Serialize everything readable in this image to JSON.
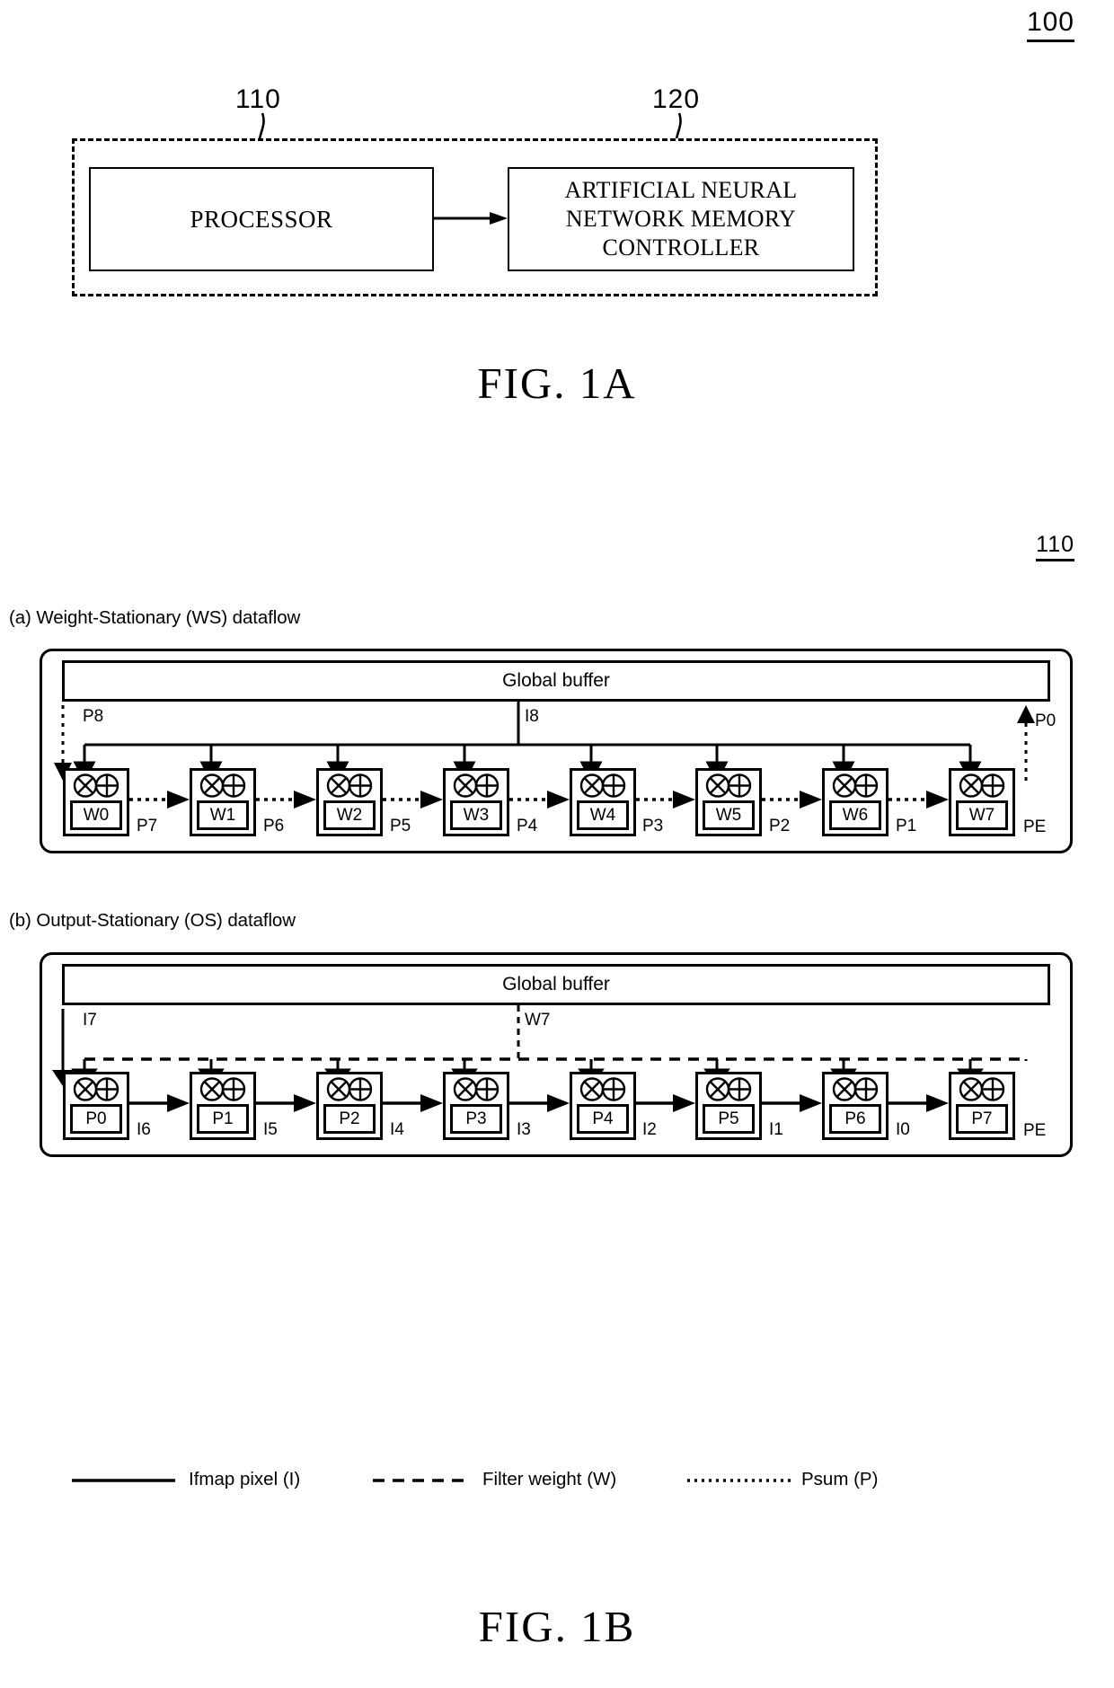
{
  "figure_1a": {
    "ref_number": "100",
    "caption": "FIG. 1A",
    "processor": {
      "ref": "110",
      "label": "PROCESSOR"
    },
    "memory_controller": {
      "ref": "120",
      "label": "ARTIFICIAL NEURAL NETWORK MEMORY CONTROLLER"
    },
    "memory_controller_lines": [
      "ARTIFICIAL NEURAL",
      "NETWORK MEMORY",
      "CONTROLLER"
    ]
  },
  "figure_1b": {
    "ref_number": "110",
    "caption": "FIG. 1B",
    "global_buffer_label": "Global buffer",
    "pe_label": "PE",
    "ws": {
      "title": "(a) Weight-Stationary (WS) dataflow",
      "psum_in_label": "P8",
      "ifmap_bus_label": "I8",
      "psum_out_label": "P0",
      "cells": [
        "W0",
        "W1",
        "W2",
        "W3",
        "W4",
        "W5",
        "W6",
        "W7"
      ],
      "between_labels": [
        "P7",
        "P6",
        "P5",
        "P4",
        "P3",
        "P2",
        "P1"
      ]
    },
    "os": {
      "title": "(b) Output-Stationary (OS) dataflow",
      "ifmap_in_label": "I7",
      "weight_bus_label": "W7",
      "cells": [
        "P0",
        "P1",
        "P2",
        "P3",
        "P4",
        "P5",
        "P6",
        "P7"
      ],
      "between_labels": [
        "I6",
        "I5",
        "I4",
        "I3",
        "I2",
        "I1",
        "I0"
      ]
    },
    "legend": [
      {
        "style": "solid",
        "label": "Ifmap pixel (I)"
      },
      {
        "style": "dashed",
        "label": "Filter weight (W)"
      },
      {
        "style": "dotted",
        "label": "Psum (P)"
      }
    ]
  },
  "icons": {
    "multiply": "multiply-circle-icon",
    "add": "plus-circle-icon"
  },
  "colors": {
    "ink": "#000000",
    "paper": "#ffffff"
  }
}
